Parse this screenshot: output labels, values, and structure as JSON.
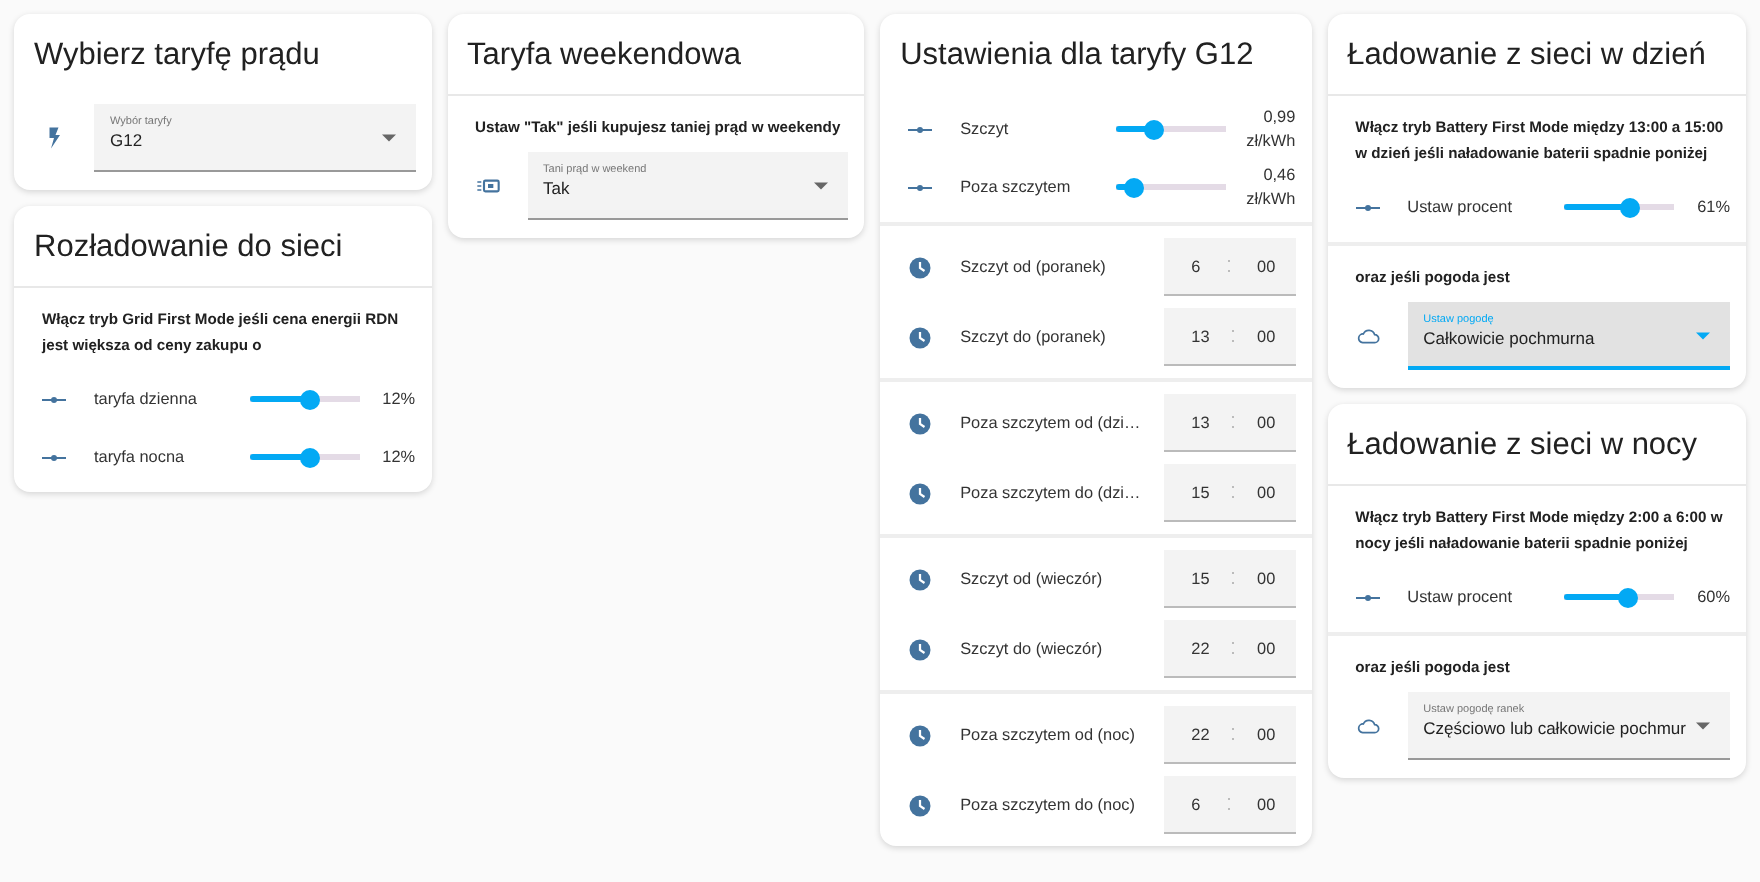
{
  "columns": [
    {
      "cards": [
        {
          "title": "Wybierz taryfę prądu",
          "header_divider": false,
          "sections": [
            {
              "items": [
                {
                  "kind": "tariff_select",
                  "label": "Wybór taryfy",
                  "value": "G12",
                  "focused": false
                }
              ]
            }
          ]
        },
        {
          "title": "Rozładowanie do sieci",
          "header_divider": true,
          "sections": [
            {
              "items": [
                {
                  "kind": "text",
                  "text": "Włącz tryb Grid First Mode jeśli cena energii RDN jest większa od ceny zakupu o"
                },
                {
                  "kind": "slider",
                  "label": "taryfa dzienna",
                  "level": 0.55,
                  "reading": "12%"
                },
                {
                  "kind": "slider",
                  "label": "taryfa nocna",
                  "level": 0.55,
                  "reading": "12%"
                }
              ]
            }
          ]
        }
      ]
    },
    {
      "cards": [
        {
          "title": "Taryfa weekendowa",
          "header_divider": true,
          "sections": [
            {
              "items": [
                {
                  "kind": "text",
                  "text": "Ustaw \"Tak\" jeśli kupujesz taniej prąd w weekendy"
                },
                {
                  "kind": "toggle_select",
                  "label": "Tani prąd w weekend",
                  "value": "Tak",
                  "focused": false
                }
              ]
            }
          ]
        }
      ]
    },
    {
      "cards": [
        {
          "title": "Ustawienia dla taryfy G12",
          "header_divider": false,
          "sections": [
            {
              "items": [
                {
                  "kind": "slider",
                  "label": "Szczyt",
                  "level": 0.35,
                  "reading": "0,99 zł/kWh"
                },
                {
                  "kind": "slider",
                  "label": "Poza szczytem",
                  "level": 0.16,
                  "reading": "0,46 zł/kWh"
                }
              ]
            },
            {
              "items": [
                {
                  "kind": "time",
                  "label": "Szczyt od (poranek)",
                  "hour": "6",
                  "minute": "00"
                },
                {
                  "kind": "time",
                  "label": "Szczyt do (poranek)",
                  "hour": "13",
                  "minute": "00"
                }
              ]
            },
            {
              "items": [
                {
                  "kind": "time",
                  "label": "Poza szczytem od (dzi…",
                  "hour": "13",
                  "minute": "00"
                },
                {
                  "kind": "time",
                  "label": "Poza szczytem do (dzi…",
                  "hour": "15",
                  "minute": "00"
                }
              ]
            },
            {
              "items": [
                {
                  "kind": "time",
                  "label": "Szczyt od (wieczór)",
                  "hour": "15",
                  "minute": "00"
                },
                {
                  "kind": "time",
                  "label": "Szczyt do (wieczór)",
                  "hour": "22",
                  "minute": "00"
                }
              ]
            },
            {
              "items": [
                {
                  "kind": "time",
                  "label": "Poza szczytem od (noc)",
                  "hour": "22",
                  "minute": "00"
                },
                {
                  "kind": "time",
                  "label": "Poza szczytem do (noc)",
                  "hour": "6",
                  "minute": "00"
                }
              ]
            }
          ]
        }
      ]
    },
    {
      "cards": [
        {
          "title": "Ładowanie z sieci w dzień",
          "header_divider": true,
          "sections": [
            {
              "items": [
                {
                  "kind": "text",
                  "text": "Włącz tryb Battery First Mode między 13:00 a 15:00 w dzień jeśli naładowanie baterii spadnie poniżej"
                },
                {
                  "kind": "slider",
                  "label": "Ustaw procent",
                  "level": 0.6,
                  "reading": "61%"
                }
              ]
            },
            {
              "items": [
                {
                  "kind": "text",
                  "text": "oraz jeśli pogoda jest"
                },
                {
                  "kind": "weather_select",
                  "label": "Ustaw pogodę",
                  "value": "Całkowicie pochmurna",
                  "focused": true
                }
              ]
            }
          ]
        },
        {
          "title": "Ładowanie z sieci w nocy",
          "header_divider": true,
          "sections": [
            {
              "items": [
                {
                  "kind": "text",
                  "text": "Włącz tryb Battery First Mode między 2:00 a 6:00 w nocy jeśli naładowanie baterii spadnie poniżej"
                },
                {
                  "kind": "slider",
                  "label": "Ustaw procent",
                  "level": 0.59,
                  "reading": "60%"
                }
              ]
            },
            {
              "items": [
                {
                  "kind": "text",
                  "text": "oraz jeśli pogoda jest"
                },
                {
                  "kind": "weather_select",
                  "label": "Ustaw pogodę ranek",
                  "value": "Częściowo lub całkowicie pochmur",
                  "focused": false
                }
              ]
            }
          ]
        }
      ]
    }
  ]
}
